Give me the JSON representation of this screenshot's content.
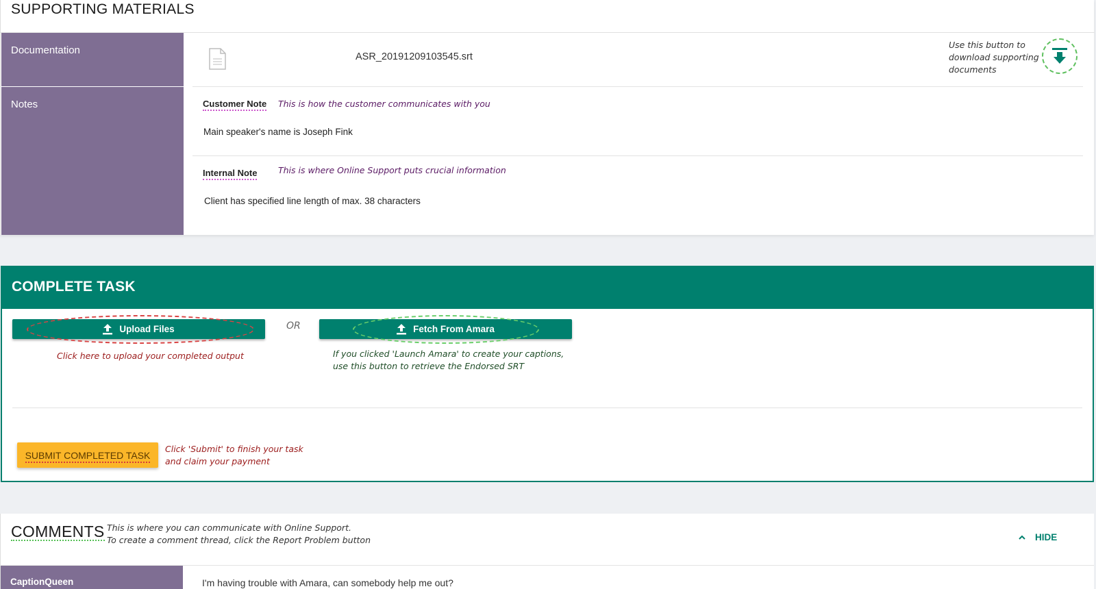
{
  "supporting": {
    "title": "SUPPORTING MATERIALS",
    "documentation_label": "Documentation",
    "file_name": "ASR_20191209103545.srt",
    "download_note": "Use this button to download supporting documents",
    "notes_label": "Notes",
    "customer_note_label": "Customer Note",
    "customer_note_desc": "This is how the customer communicates with you",
    "customer_note_text": "Main speaker's name is Joseph Fink",
    "internal_note_label": "Internal Note",
    "internal_note_desc": "This is where Online Support puts crucial information",
    "internal_note_text": "Client has specified line length of max. 38 characters"
  },
  "complete": {
    "title": "COMPLETE TASK",
    "upload_label": "Upload Files",
    "or_label": "OR",
    "fetch_label": "Fetch From Amara",
    "upload_note": "Click here to upload your completed output",
    "fetch_note_line1": "If you clicked 'Launch Amara' to create your captions,",
    "fetch_note_line2": "use this button to retrieve the Endorsed SRT",
    "submit_label": "SUBMIT COMPLETED TASK",
    "submit_note_line1": "Click 'Submit' to finish your task",
    "submit_note_line2": "and claim your payment"
  },
  "comments": {
    "title": "COMMENTS",
    "note_line1": "This is where you can communicate with Online Support.",
    "note_line2": "To create a comment thread, click the Report Problem button",
    "hide_label": "HIDE",
    "user": "CaptionQueen",
    "text": "I'm having trouble with Amara, can somebody help me out?"
  },
  "colors": {
    "teal": "#00806e",
    "purple": "#7f6e93",
    "amber": "#fbb629"
  }
}
